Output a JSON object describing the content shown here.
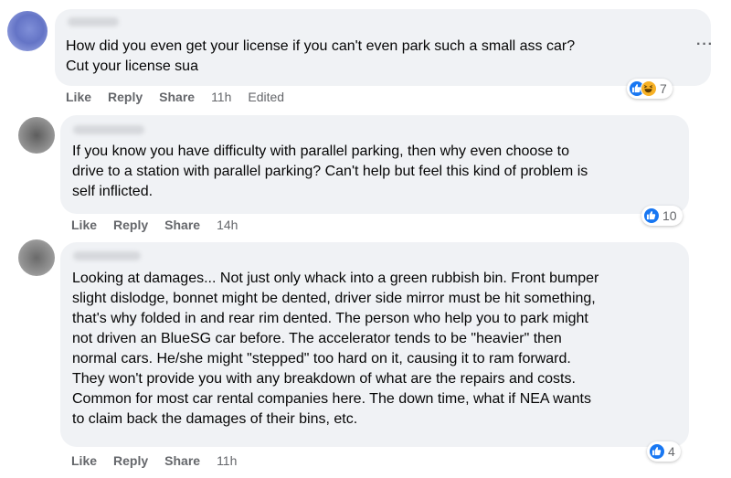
{
  "comments": [
    {
      "text": "How did you even get your license if you can't even park such a small ass car?\nCut your license sua",
      "actions": {
        "like": "Like",
        "reply": "Reply",
        "share": "Share",
        "time": "11h",
        "edited": "Edited"
      },
      "reactions": {
        "icons": [
          "like-icon",
          "haha-icon"
        ],
        "count": "7"
      }
    },
    {
      "text": "If you know you have difficulty with parallel parking, then why even choose to\ndrive to a station with parallel parking? Can't help but feel this kind of problem is\nself inflicted.",
      "actions": {
        "like": "Like",
        "reply": "Reply",
        "share": "Share",
        "time": "14h"
      },
      "reactions": {
        "icons": [
          "like-icon"
        ],
        "count": "10"
      }
    },
    {
      "text": "Looking at damages... Not just only whack into a green rubbish bin. Front bumper\nslight dislodge, bonnet might be dented, driver side mirror must be hit something,\nthat's why folded in and rear rim dented. The person who help you to park might\nnot driven an BlueSG car before. The accelerator tends to be \"heavier\" then\nnormal cars. He/she might \"stepped\" too hard on it, causing it to ram forward.\nThey won't provide you with any breakdown of what are the repairs and costs.\nCommon for most car rental companies here. The down time, what if NEA wants\nto claim back the damages of their bins, etc.",
      "actions": {
        "like": "Like",
        "reply": "Reply",
        "share": "Share",
        "time": "11h"
      },
      "reactions": {
        "icons": [
          "like-icon"
        ],
        "count": "4"
      }
    }
  ],
  "more_options": "···",
  "colors": {
    "bubble": "#f0f2f5",
    "like_blue": "#1877f2",
    "haha_yellow": "#f7b125",
    "meta_gray": "#65676b"
  }
}
